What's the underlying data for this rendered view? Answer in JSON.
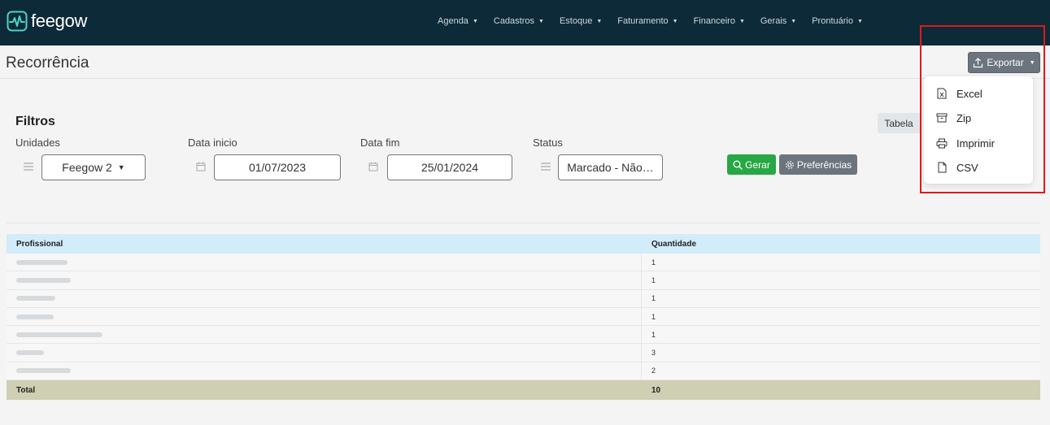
{
  "app": {
    "logo_text": "feegow"
  },
  "nav": {
    "menu": [
      "Agenda",
      "Cadastros",
      "Estoque",
      "Faturamento",
      "Financeiro",
      "Gerais",
      "Prontuário"
    ]
  },
  "page": {
    "title": "Recorrência"
  },
  "export": {
    "label": "Exportar",
    "options": [
      "Excel",
      "Zip",
      "Imprimir",
      "CSV"
    ]
  },
  "filters": {
    "title": "Filtros",
    "view_toggle": "Tabela",
    "unidades": {
      "label": "Unidades",
      "value": "Feegow 2"
    },
    "data_inicio": {
      "label": "Data inicio",
      "value": "01/07/2023"
    },
    "data_fim": {
      "label": "Data fim",
      "value": "25/01/2024"
    },
    "status": {
      "label": "Status",
      "value": "Marcado - Não…"
    },
    "gerar_label": "Gerar",
    "preferencias_label": "Preferências"
  },
  "table": {
    "headers": [
      "Profissional",
      "Quantidade"
    ],
    "rows": [
      {
        "quantidade": "1"
      },
      {
        "quantidade": "1"
      },
      {
        "quantidade": "1"
      },
      {
        "quantidade": "1"
      },
      {
        "quantidade": "1"
      },
      {
        "quantidade": "3"
      },
      {
        "quantidade": "2"
      }
    ],
    "total_label": "Total",
    "total_value": "10"
  },
  "colors": {
    "navbar": "#0d2a38",
    "header_row": "#d2ecfa",
    "total_row": "#cfcfb3",
    "gerar": "#28a745",
    "secondary": "#6c757d",
    "highlight_frame": "#e01919"
  }
}
